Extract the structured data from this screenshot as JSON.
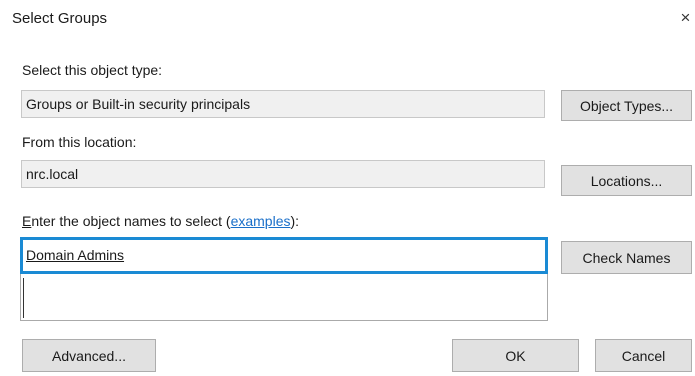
{
  "dialog": {
    "title": "Select Groups",
    "close_glyph": "×"
  },
  "object_type": {
    "label": "Select this object type:",
    "value": "Groups or Built-in security principals",
    "button": "Object Types..."
  },
  "location": {
    "label": "From this location:",
    "value": "nrc.local",
    "button": "Locations..."
  },
  "object_names": {
    "label_prefix_underlined": "E",
    "label_middle": "nter the object names to select (",
    "label_link": "examples",
    "label_suffix": "):",
    "value": "Domain Admins",
    "check_button": "Check Names"
  },
  "footer": {
    "advanced_button": "Advanced...",
    "ok_button": "OK",
    "cancel_button": "Cancel"
  },
  "colors": {
    "focus_border": "#1a8ad4",
    "link": "#1a6fc9",
    "button_face": "#e1e1e1",
    "readonly_field": "#f0f0f0"
  }
}
